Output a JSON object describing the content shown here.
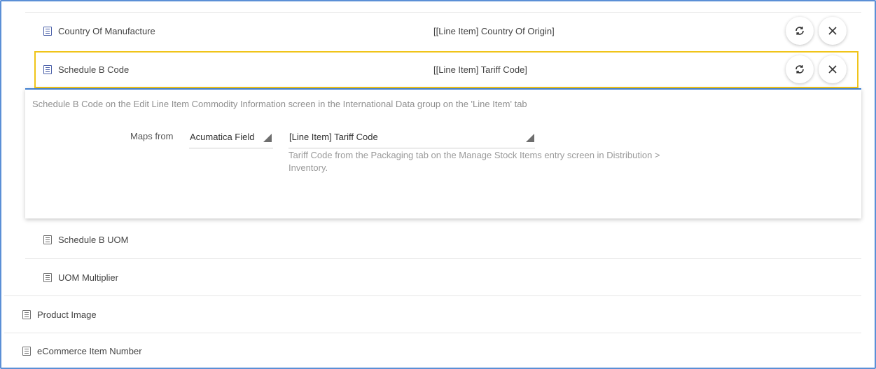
{
  "rows_top": [
    {
      "label": "Country Of Manufacture",
      "value": "[[Line Item] Country Of Origin]"
    },
    {
      "label": "Schedule B Code",
      "value": "[[Line Item] Tariff Code]"
    }
  ],
  "row_actions": {
    "refresh_icon": "refresh-icon",
    "remove_icon": "close-icon"
  },
  "panel": {
    "description": "Schedule B Code on the Edit Line Item Commodity Information screen in the International Data group on the 'Line Item' tab",
    "maps_from_label": "Maps from",
    "source_type": "Acumatica Field",
    "source_field": "[Line Item] Tariff Code",
    "help_text": "Tariff Code from the Packaging tab on the Manage Stock Items entry screen in Distribution > Inventory."
  },
  "rows_bottom_nested": [
    {
      "label": "Schedule B UOM"
    },
    {
      "label": "UOM Multiplier"
    }
  ],
  "rows_bottom": [
    {
      "label": "Product Image"
    },
    {
      "label": "eCommerce Item Number"
    }
  ],
  "colors": {
    "highlight": "#f0c419",
    "panel_accent": "#3f7fd0",
    "frame": "#5b8fd6"
  }
}
